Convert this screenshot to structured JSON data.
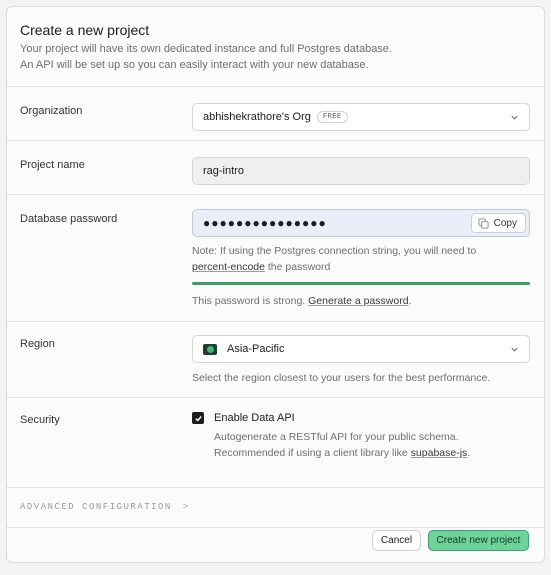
{
  "header": {
    "title": "Create a new project",
    "subtitle_line1": "Your project will have its own dedicated instance and full Postgres database.",
    "subtitle_line2": "An API will be set up so you can easily interact with your new database."
  },
  "organization": {
    "label": "Organization",
    "value": "abhishekrathore's Org",
    "badge": "FREE"
  },
  "project_name": {
    "label": "Project name",
    "value": "rag-intro"
  },
  "password": {
    "label": "Database password",
    "value": "●●●●●●●●●●●●●●●",
    "copy_label": "Copy",
    "note_line1": "Note: If using the Postgres connection string, you will need to",
    "note_link": "percent-encode",
    "note_after_link": " the password",
    "strength_fraction": 1.0,
    "strength_color": "#3c9b62",
    "strength_text": "This password is strong. ",
    "generate_link": "Generate a password",
    "generate_after": "."
  },
  "region": {
    "label": "Region",
    "value": "Asia-Pacific",
    "help": "Select the region closest to your users for the best performance."
  },
  "security": {
    "label": "Security",
    "checkbox_label": "Enable Data API",
    "checked": true,
    "desc_line1": "Autogenerate a RESTful API for your public schema.",
    "desc_line2_prefix": "Recommended if using a client library like ",
    "desc_link": "supabase-js",
    "desc_line2_suffix": "."
  },
  "advanced": {
    "label": "ADVANCED CONFIGURATION",
    "chevron": ">"
  },
  "footer": {
    "cancel_label": "Cancel",
    "create_label": "Create new project",
    "accent_color": "#6ed39a"
  }
}
